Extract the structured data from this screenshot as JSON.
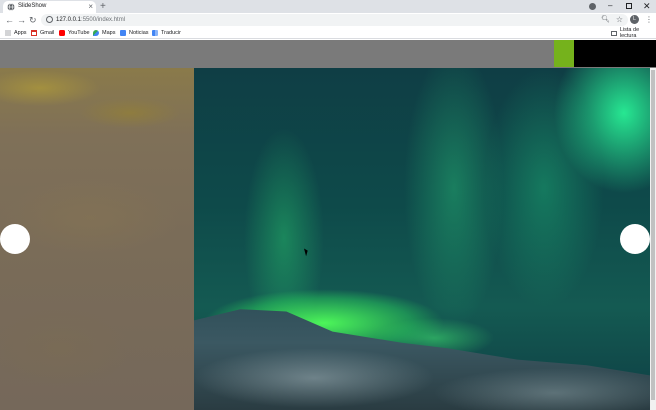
{
  "browser": {
    "tab": {
      "title": "SlideShow",
      "close": "×"
    },
    "new_tab": "+",
    "window": {
      "minimize": "–",
      "close": "✕"
    },
    "nav": {
      "back": "←",
      "forward": "→",
      "reload": "↻"
    },
    "url": {
      "host": "127.0.0.1",
      "path": ":5500/index.html"
    },
    "avatar_initial": "L",
    "menu": "⋮"
  },
  "bookmarks": {
    "items": [
      {
        "label": "Apps",
        "icon": "apps-grid-icon"
      },
      {
        "label": "Gmail",
        "icon": "gmail-icon",
        "color": "#d93025"
      },
      {
        "label": "YouTube",
        "icon": "youtube-icon",
        "color": "#ff0000"
      },
      {
        "label": "Maps",
        "icon": "maps-icon",
        "color": "#34a853"
      },
      {
        "label": "Noticias",
        "icon": "news-icon",
        "color": "#4285f4"
      },
      {
        "label": "Traducir",
        "icon": "translate-icon",
        "color": "#4285f4"
      }
    ],
    "reading_list": "Lista de lectura"
  },
  "page": {
    "accent_green": "#75b21c",
    "header_color": "#7a7a7a"
  }
}
